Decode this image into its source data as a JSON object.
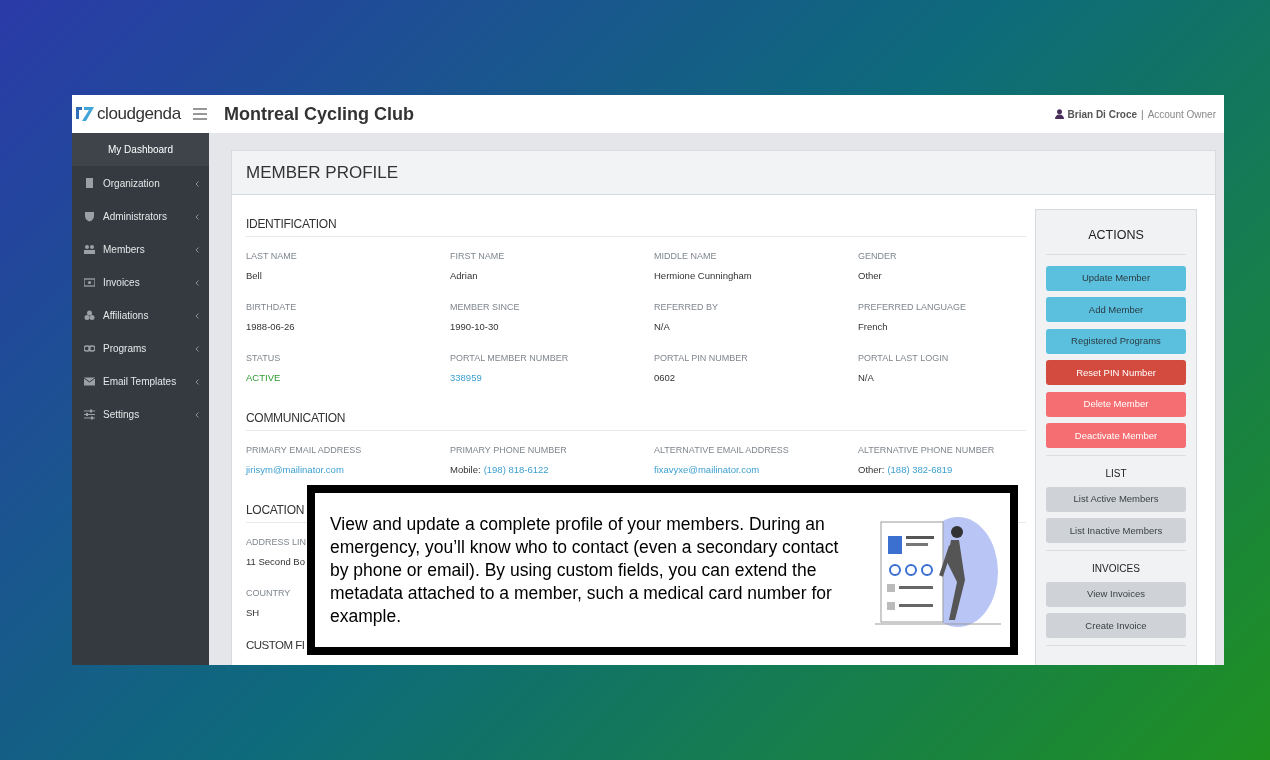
{
  "app": {
    "logo": "cloudgenda",
    "org_title": "Montreal Cycling Club",
    "user": {
      "name": "Brian Di Croce",
      "separator": "|",
      "role": "Account Owner"
    }
  },
  "sidebar": {
    "items": [
      {
        "label": "My Dashboard",
        "selected": true
      },
      {
        "label": "Organization",
        "selected": false
      },
      {
        "label": "Administrators",
        "selected": false
      },
      {
        "label": "Members",
        "selected": false
      },
      {
        "label": "Invoices",
        "selected": false
      },
      {
        "label": "Affiliations",
        "selected": false
      },
      {
        "label": "Programs",
        "selected": false
      },
      {
        "label": "Email Templates",
        "selected": false
      },
      {
        "label": "Settings",
        "selected": false
      }
    ]
  },
  "page_title": "MEMBER PROFILE",
  "sections": [
    {
      "title": "IDENTIFICATION",
      "kind": "grid",
      "fields": [
        {
          "label": "LAST NAME",
          "value": "Bell",
          "kind": "text"
        },
        {
          "label": "FIRST NAME",
          "value": "Adrian",
          "kind": "text"
        },
        {
          "label": "MIDDLE NAME",
          "value": "Hermione Cunningham",
          "kind": "text"
        },
        {
          "label": "GENDER",
          "value": "Other",
          "kind": "text"
        },
        {
          "label": "BIRTHDATE",
          "value": "1988-06-26",
          "kind": "text"
        },
        {
          "label": "MEMBER SINCE",
          "value": "1990-10-30",
          "kind": "text"
        },
        {
          "label": "REFERRED BY",
          "value": "N/A",
          "kind": "text"
        },
        {
          "label": "PREFERRED LANGUAGE",
          "value": "French",
          "kind": "text"
        },
        {
          "label": "STATUS",
          "value": "ACTIVE",
          "kind": "status"
        },
        {
          "label": "PORTAL MEMBER NUMBER",
          "value": "338959",
          "kind": "link"
        },
        {
          "label": "PORTAL PIN NUMBER",
          "value": "0602",
          "kind": "text"
        },
        {
          "label": "PORTAL LAST LOGIN",
          "value": "N/A",
          "kind": "text"
        }
      ]
    },
    {
      "title": "COMMUNICATION",
      "kind": "grid",
      "fields": [
        {
          "label": "PRIMARY EMAIL ADDRESS",
          "value": "jirisym@mailinator.com",
          "kind": "link"
        },
        {
          "label": "PRIMARY PHONE NUMBER",
          "prefix": "Mobile:",
          "value": "(198) 818-6122",
          "kind": "link"
        },
        {
          "label": "ALTERNATIVE EMAIL ADDRESS",
          "value": "fixavyxe@mailinator.com",
          "kind": "link"
        },
        {
          "label": "ALTERNATIVE PHONE NUMBER",
          "prefix": "Other:",
          "value": "(188) 382-6819",
          "kind": "link"
        }
      ]
    },
    {
      "title": "LOCATION",
      "kind": "stacked",
      "fields": [
        {
          "label": "ADDRESS LIN",
          "value": "11 Second Bo",
          "kind": "text"
        },
        {
          "label": "COUNTRY",
          "value": "SH",
          "kind": "text"
        }
      ]
    },
    {
      "title": "CUSTOM FI"
    }
  ],
  "actions": [
    {
      "title": "ACTIONS",
      "buttons": [
        {
          "label": "Update Member",
          "kind": "info"
        },
        {
          "label": "Add Member",
          "kind": "info"
        },
        {
          "label": "Registered Programs",
          "kind": "info"
        },
        {
          "label": "Reset PIN Number",
          "kind": "danger"
        },
        {
          "label": "Delete Member",
          "kind": "alert"
        },
        {
          "label": "Deactivate Member",
          "kind": "alert"
        }
      ]
    },
    {
      "title": "LIST",
      "buttons": [
        {
          "label": "List Active Members",
          "kind": "muted"
        },
        {
          "label": "List Inactive Members",
          "kind": "muted"
        }
      ]
    },
    {
      "title": "INVOICES",
      "buttons": [
        {
          "label": "View Invoices",
          "kind": "muted"
        },
        {
          "label": "Create Invoice",
          "kind": "muted"
        }
      ]
    }
  ],
  "callout": {
    "text": "View and update a complete profile of your members. During an emergency, you’ll know who to contact (even a secondary contact by phone or email). By using custom fields, you can extend the metadata attached to a member, such a medical card number for example."
  }
}
